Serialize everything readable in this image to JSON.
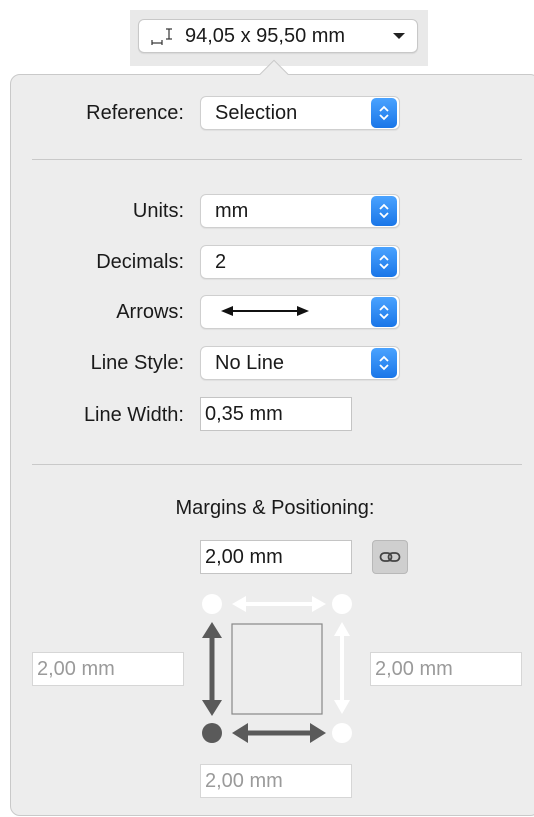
{
  "toolbar": {
    "dimension_label": "94,05 x 95,50 mm",
    "dimension_icon": "dimension-icon",
    "dropdown_icon": "chevron-down-icon"
  },
  "popover": {
    "reference": {
      "label": "Reference:",
      "value": "Selection"
    },
    "units": {
      "label": "Units:",
      "value": "mm"
    },
    "decimals": {
      "label": "Decimals:",
      "value": "2"
    },
    "arrows": {
      "label": "Arrows:",
      "value_icon": "double-arrow-icon"
    },
    "line_style": {
      "label": "Line Style:",
      "value": "No Line"
    },
    "line_width": {
      "label": "Line Width:",
      "value": "0,35 mm"
    },
    "margins": {
      "heading": "Margins & Positioning:",
      "top": "2,00 mm",
      "left": "2,00 mm",
      "right": "2,00 mm",
      "bottom": "2,00 mm",
      "link_icon": "link-icon"
    }
  },
  "colors": {
    "accent": "#1a76e8",
    "popover_bg": "#ededed",
    "arrow_active": "#5a5a5a",
    "arrow_inactive": "#ffffff"
  }
}
